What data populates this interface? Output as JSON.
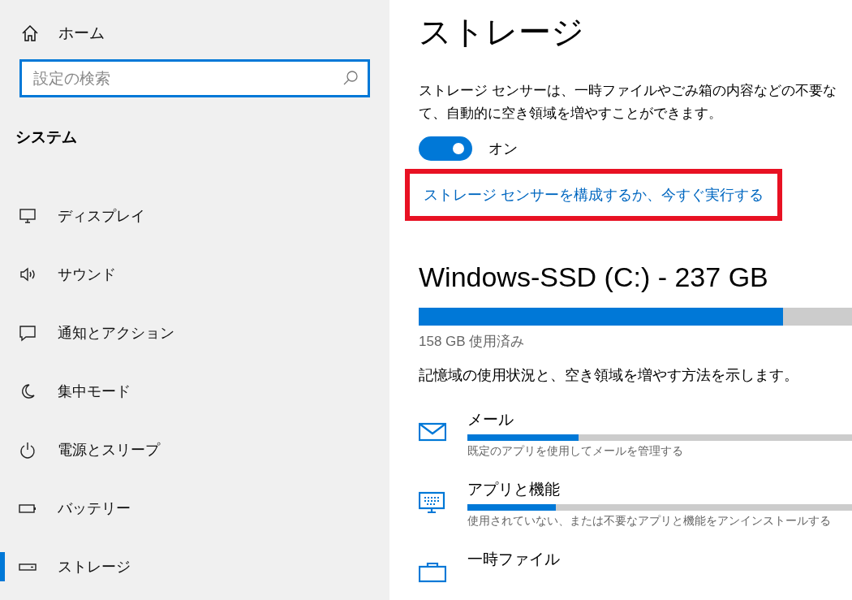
{
  "sidebar": {
    "home": {
      "label": "ホーム"
    },
    "search": {
      "placeholder": "設定の検索",
      "focused": true
    },
    "section_title": "システム",
    "items": [
      {
        "label": "ディスプレイ",
        "selected": false
      },
      {
        "label": "サウンド",
        "selected": false
      },
      {
        "label": "通知とアクション",
        "selected": false
      },
      {
        "label": "集中モード",
        "selected": false
      },
      {
        "label": "電源とスリープ",
        "selected": false
      },
      {
        "label": "バッテリー",
        "selected": false
      },
      {
        "label": "ストレージ",
        "selected": true
      }
    ]
  },
  "main": {
    "title": "ストレージ",
    "description_lines": [
      "ストレージ センサーは、一時ファイルやごみ箱の内容などの不要な",
      "て、自動的に空き領域を増やすことができます。"
    ],
    "toggle": {
      "on": true,
      "label": "オン"
    },
    "link": {
      "text": "ストレージ センサーを構成するか、今すぐ実行する",
      "highlighted": true
    },
    "drive": {
      "title": "Windows-SSD (C:) - 237 GB",
      "level": 0.84,
      "used": "158 GB 使用済み"
    },
    "drive_description": "記憶域の使用状況と、空き領域を増やす方法を示します。",
    "categories": [
      {
        "title": "メール",
        "level": 0.29,
        "subtitle": "既定のアプリを使用してメールを管理する"
      },
      {
        "title": "アプリと機能",
        "level": 0.23,
        "subtitle": "使用されていない、または不要なアプリと機能をアンインストールする"
      },
      {
        "title": "一時ファイル"
      }
    ]
  }
}
